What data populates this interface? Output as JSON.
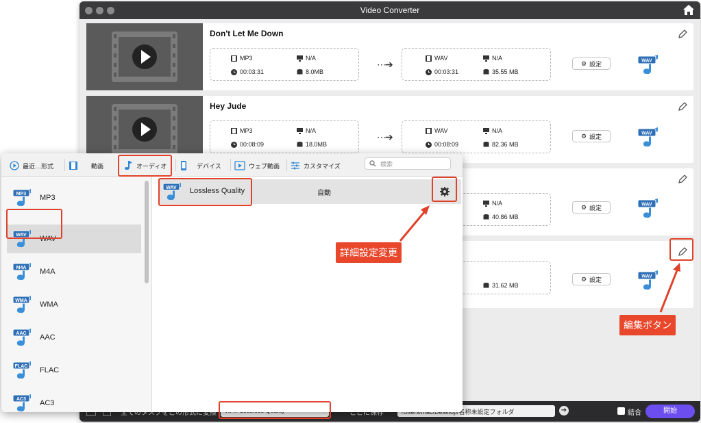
{
  "window": {
    "title": "Video Converter"
  },
  "rows": [
    {
      "title": "Don't Let Me Down",
      "src_format": "MP3",
      "src_res": "N/A",
      "src_duration": "00:03:31",
      "src_size": "8.0MB",
      "dst_format": "WAV",
      "dst_res": "N/A",
      "dst_duration": "00:03:31",
      "dst_size": "35.55 MB",
      "settings_label": "設定"
    },
    {
      "title": "Hey Jude",
      "src_format": "MP3",
      "src_res": "N/A",
      "src_duration": "00:08:09",
      "src_size": "18.0MB",
      "dst_format": "WAV",
      "dst_res": "N/A",
      "dst_duration": "00:08:09",
      "dst_size": "82.36 MB",
      "settings_label": "設定"
    },
    {
      "dst_res": "N/A",
      "dst_size": "40.86 MB",
      "settings_label": "設定"
    },
    {
      "dst_size": "31.62 MB",
      "settings_label": "設定"
    }
  ],
  "bottom_bar": {
    "convert_all_label": "全てのタスクをこの形式に変換",
    "format_value": "WAV Lossless Quality",
    "save_label": "ここに保存",
    "path": "/Users/mac/Desktop/名称未設定フォルダ",
    "merge_label": "結合",
    "start_label": "開始"
  },
  "panel": {
    "tabs": [
      {
        "label": "最近…形式",
        "icon": "recent-icon"
      },
      {
        "label": "動画",
        "icon": "film-icon"
      },
      {
        "label": "オーディオ",
        "icon": "music-note-icon"
      },
      {
        "label": "デバイス",
        "icon": "phone-icon"
      },
      {
        "label": "ウェブ動画",
        "icon": "web-video-icon"
      },
      {
        "label": "カスタマイズ",
        "icon": "sliders-icon"
      }
    ],
    "search_placeholder": "検索",
    "formats": [
      {
        "badge": "MP3",
        "label": "MP3"
      },
      {
        "badge": "WAV",
        "label": "WAV"
      },
      {
        "badge": "M4A",
        "label": "M4A"
      },
      {
        "badge": "WMA",
        "label": "WMA"
      },
      {
        "badge": "AAC",
        "label": "AAC"
      },
      {
        "badge": "FLAC",
        "label": "FLAC"
      },
      {
        "badge": "AC3",
        "label": "AC3"
      }
    ],
    "preset": {
      "badge": "WAV",
      "name": "Lossless Quality",
      "value": "自動"
    }
  },
  "annotations": {
    "advanced_settings": "詳細設定変更",
    "edit_button": "編集ボタン"
  },
  "colors": {
    "accent": "#6c4ef0",
    "callout": "#e8472c",
    "badge_blue": "#2f6fb6"
  }
}
